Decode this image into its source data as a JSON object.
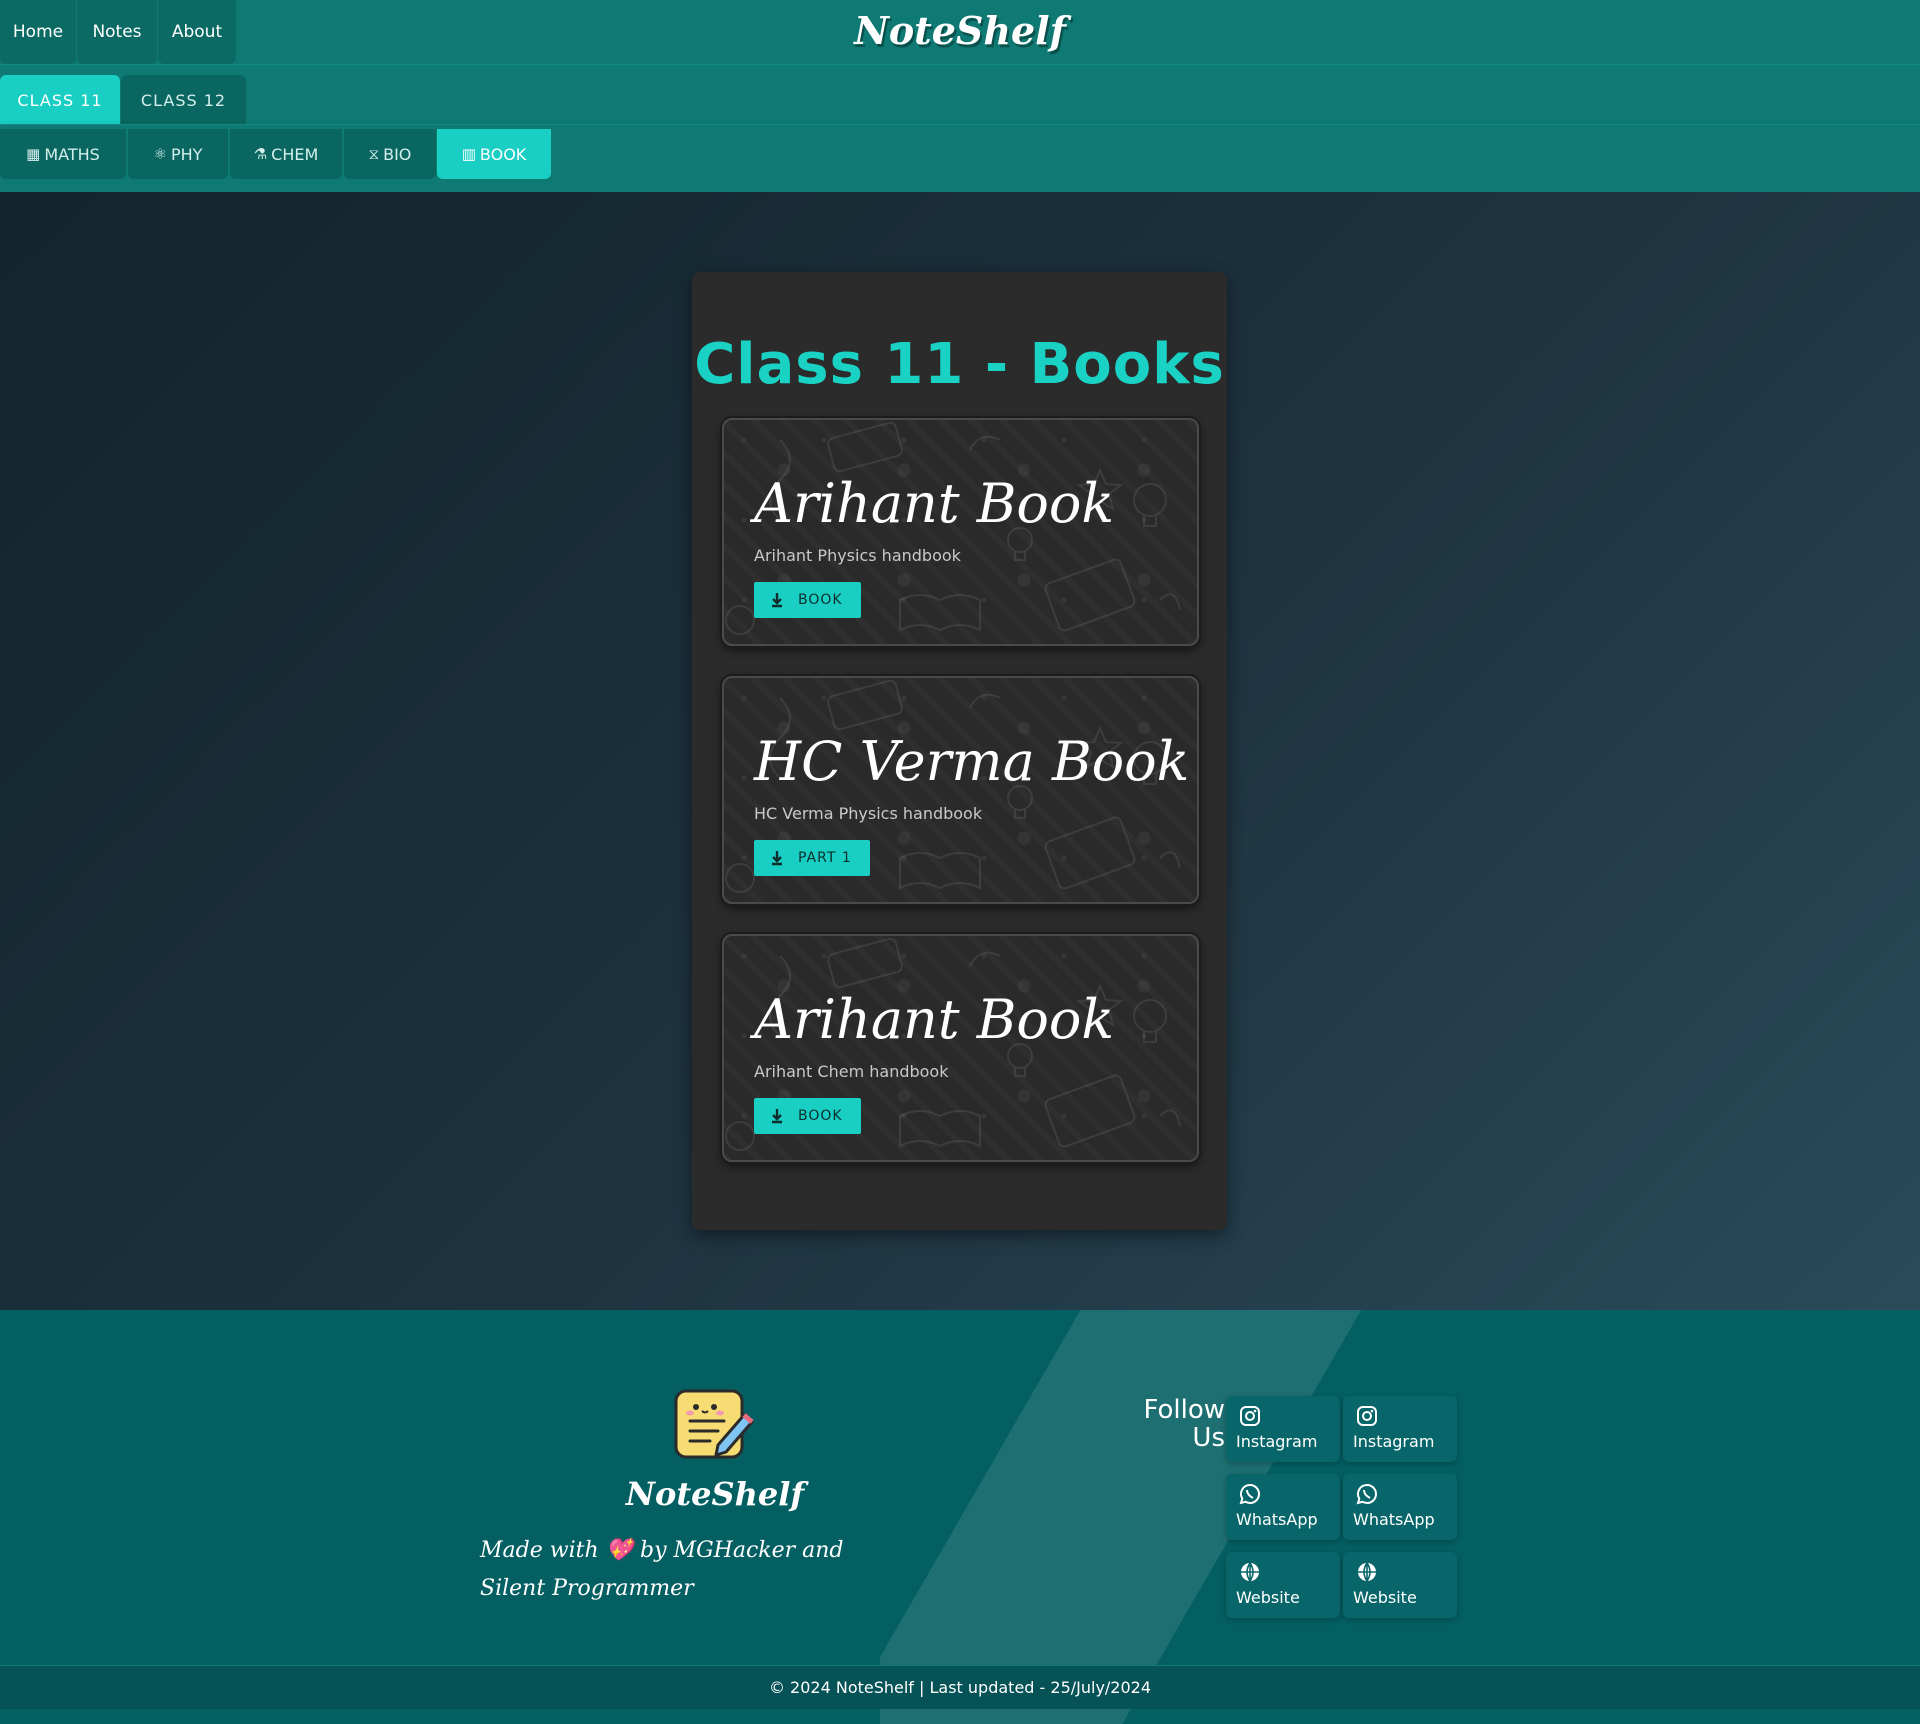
{
  "header": {
    "nav": [
      "Home",
      "Notes",
      "About"
    ],
    "brand": "NoteShelf"
  },
  "class_tabs": [
    {
      "label": "CLASS 11",
      "active": true
    },
    {
      "label": "CLASS 12",
      "active": false
    }
  ],
  "subject_tabs": [
    {
      "label": "MATHS",
      "icon": "calculator-icon",
      "glyph": "▦",
      "active": false
    },
    {
      "label": "PHY",
      "icon": "atom-icon",
      "glyph": "⚛",
      "active": false
    },
    {
      "label": "CHEM",
      "icon": "flask-icon",
      "glyph": "⚗",
      "active": false
    },
    {
      "label": "BIO",
      "icon": "dna-icon",
      "glyph": "⧖",
      "active": false
    },
    {
      "label": "BOOK",
      "icon": "book-icon",
      "glyph": "▥",
      "active": true
    }
  ],
  "main": {
    "title": "Class 11 - Books",
    "cards": [
      {
        "title": "Arihant Book",
        "subtitle": "Arihant Physics handbook",
        "button": "BOOK"
      },
      {
        "title": "HC Verma Book",
        "subtitle": "HC Verma Physics handbook",
        "button": "PART 1"
      },
      {
        "title": "Arihant Book",
        "subtitle": "Arihant Chem handbook",
        "button": "BOOK"
      }
    ]
  },
  "footer": {
    "brand": "NoteShelf",
    "made_with": "Made with",
    "heart": "💖",
    "made_by": "by MGHacker and Silent Programmer",
    "follow": [
      "Follow",
      "Us"
    ],
    "social": [
      {
        "label": "Instagram",
        "icon": "instagram-icon"
      },
      {
        "label": "Instagram",
        "icon": "instagram-icon"
      },
      {
        "label": "WhatsApp",
        "icon": "whatsapp-icon"
      },
      {
        "label": "WhatsApp",
        "icon": "whatsapp-icon"
      },
      {
        "label": "Website",
        "icon": "globe-icon"
      },
      {
        "label": "Website",
        "icon": "globe-icon"
      }
    ],
    "copyright": "© 2024 NoteShelf | Last updated - 25/July/2024"
  },
  "colors": {
    "accent": "#19cfc3",
    "header_bg": "#0e7a73",
    "footer_bg": "#045f62",
    "card_bg": "#2a2a2a"
  }
}
